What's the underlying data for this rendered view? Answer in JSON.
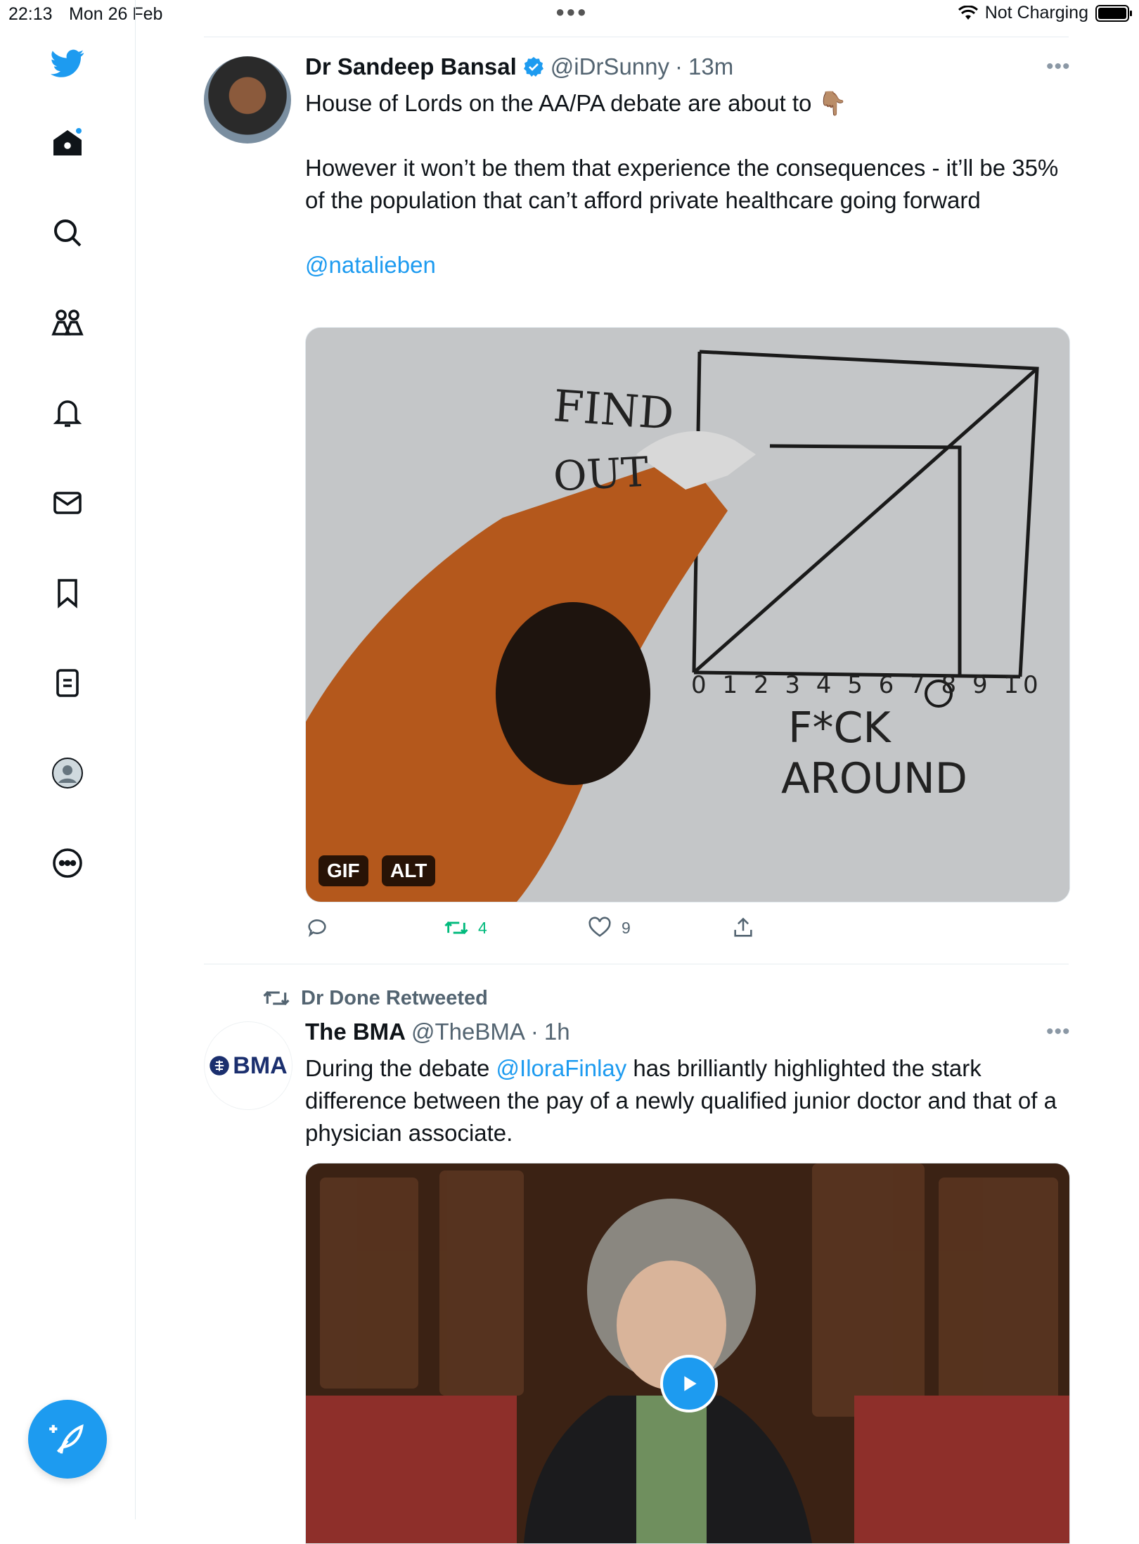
{
  "status_bar": {
    "time": "22:13",
    "date": "Mon 26 Feb",
    "network": "Not Charging"
  },
  "nav": [
    {
      "name": "twitter-logo-icon"
    },
    {
      "name": "home-icon"
    },
    {
      "name": "search-icon"
    },
    {
      "name": "communities-icon"
    },
    {
      "name": "notifications-icon"
    },
    {
      "name": "messages-icon"
    },
    {
      "name": "bookmarks-icon"
    },
    {
      "name": "lists-icon"
    },
    {
      "name": "profile-icon"
    },
    {
      "name": "more-icon"
    }
  ],
  "colors": {
    "accent": "#1d9bf0",
    "retweet_green": "#00ba7c",
    "muted": "#536471"
  },
  "tweet1": {
    "author": "Dr Sandeep Bansal",
    "handle": "@iDrSunny",
    "time": "13m",
    "text_line1": "House of Lords on the AA/PA debate are about to 👇🏽",
    "text_para2": "However it won’t be them that experience the consequences - it’ll be 35% of the population that can’t afford private healthcare going forward",
    "mention": "@natalieben",
    "media_badges": [
      "GIF",
      "ALT"
    ],
    "whiteboard": {
      "top": "FIND",
      "top2": "OUT",
      "bottom": "F*CK",
      "bottom2": "AROUND",
      "ticks": "0 1 2 3 4 5 6 7 8 9 10"
    },
    "actions": {
      "reply": "",
      "retweets": "4",
      "likes": "9"
    }
  },
  "tweet2": {
    "retweeted_by": "Dr Done Retweeted",
    "author": "The BMA",
    "handle": "@TheBMA",
    "time": "1h",
    "avatar_text": "BMA",
    "text_before": "During the debate ",
    "mention": "@IloraFinlay",
    "text_after": " has brilliantly highlighted the stark difference between the pay of a newly qualified junior doctor and that of a physician associate."
  }
}
